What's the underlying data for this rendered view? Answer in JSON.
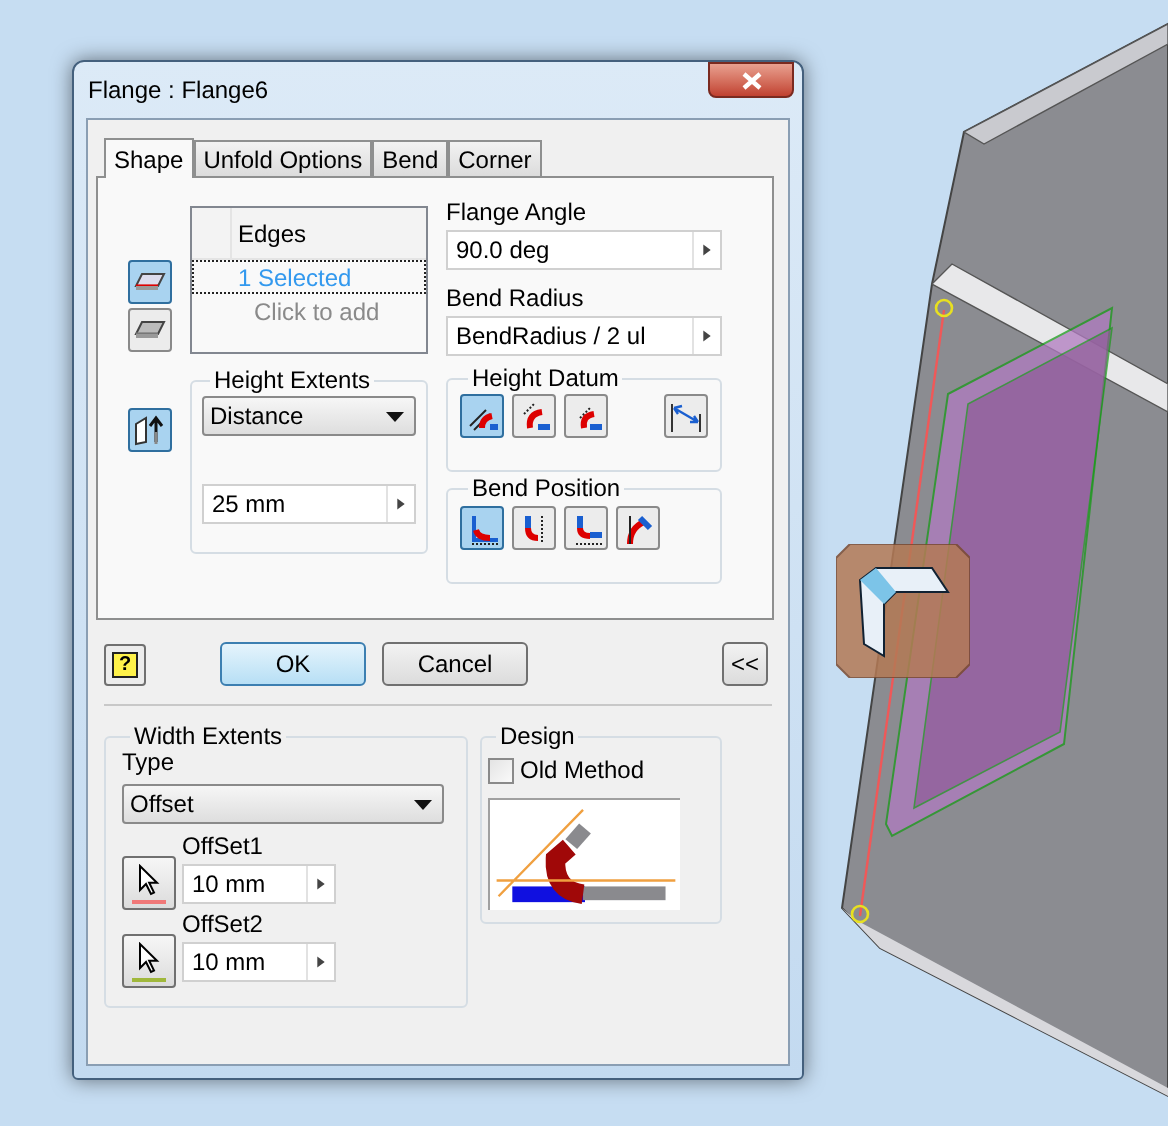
{
  "window": {
    "title": "Flange : Flange6"
  },
  "tabs": [
    {
      "label": "Shape",
      "selected": true
    },
    {
      "label": "Unfold Options",
      "selected": false
    },
    {
      "label": "Bend",
      "selected": false
    },
    {
      "label": "Corner",
      "selected": false
    }
  ],
  "edge_modes": [
    {
      "selected": true
    },
    {
      "selected": false
    }
  ],
  "flip_direction": {
    "on": true
  },
  "edges": {
    "header": "Edges",
    "items": [
      {
        "text": "1 Selected",
        "selected": true
      },
      {
        "text": "Click to add",
        "selected": false
      }
    ]
  },
  "flange_angle": {
    "label": "Flange Angle",
    "value": "90.0 deg"
  },
  "bend_radius": {
    "label": "Bend Radius",
    "value": "BendRadius / 2 ul"
  },
  "height_extents": {
    "title": "Height Extents",
    "type": "Distance",
    "value": "25 mm"
  },
  "height_datum": {
    "title": "Height Datum",
    "options": [
      {
        "selected": true
      },
      {
        "selected": false
      },
      {
        "selected": false
      }
    ],
    "align": {
      "selected": false
    }
  },
  "bend_position": {
    "title": "Bend Position",
    "options": [
      {
        "selected": true
      },
      {
        "selected": false
      },
      {
        "selected": false
      },
      {
        "selected": false
      }
    ]
  },
  "buttons": {
    "help": "?",
    "ok": "OK",
    "cancel": "Cancel",
    "more": "<<"
  },
  "width_extents": {
    "title": "Width Extents",
    "type_label": "Type",
    "type": "Offset",
    "offsets": [
      {
        "label": "OffSet1",
        "value": "10 mm",
        "color": "#f07878"
      },
      {
        "label": "OffSet2",
        "value": "10 mm",
        "color": "#a0b83c"
      }
    ]
  },
  "design": {
    "title": "Design",
    "old_method": {
      "label": "Old Method",
      "checked": false
    }
  }
}
